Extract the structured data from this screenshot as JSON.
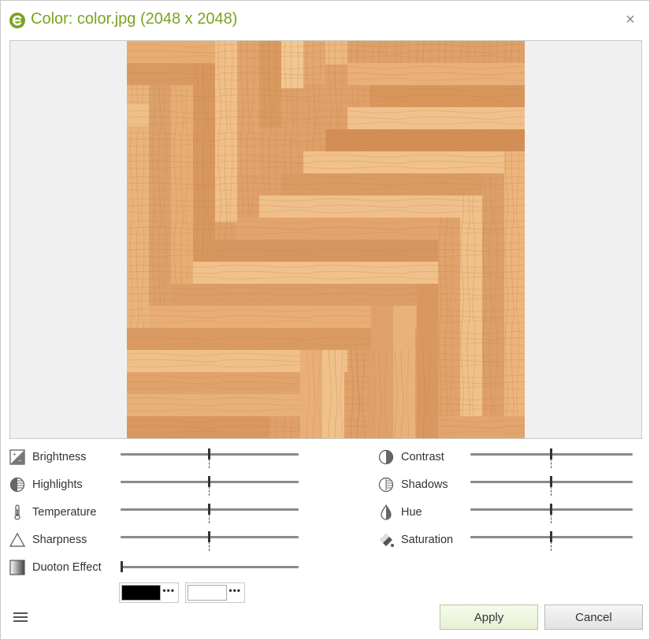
{
  "dialog": {
    "title": "Color: color.jpg (2048 x 2048)",
    "accent_color": "#7aa320",
    "close_icon": "close-icon"
  },
  "preview": {
    "image_description_icon": "herringbone-wood-texture"
  },
  "adjustments": {
    "left": [
      {
        "key": "brightness",
        "label": "Brightness",
        "icon": "brightness-icon",
        "level": 0.5
      },
      {
        "key": "highlights",
        "label": "Highlights",
        "icon": "highlights-icon",
        "level": 0.5
      },
      {
        "key": "temperature",
        "label": "Temperature",
        "icon": "thermometer-icon",
        "level": 0.5
      },
      {
        "key": "sharpness",
        "label": "Sharpness",
        "icon": "triangle-icon",
        "level": 0.5
      },
      {
        "key": "duoton",
        "label": "Duoton Effect",
        "icon": "gradient-icon",
        "level": 0.0
      }
    ],
    "right": [
      {
        "key": "contrast",
        "label": "Contrast",
        "icon": "contrast-icon",
        "level": 0.5
      },
      {
        "key": "shadows",
        "label": "Shadows",
        "icon": "shadows-icon",
        "level": 0.5
      },
      {
        "key": "hue",
        "label": "Hue",
        "icon": "drop-icon",
        "level": 0.5
      },
      {
        "key": "saturation",
        "label": "Saturation",
        "icon": "paint-bucket-icon",
        "level": 0.5
      }
    ]
  },
  "duoton": {
    "dark_color": "#000000",
    "light_color": "#ffffff",
    "more_label": "•••"
  },
  "footer": {
    "apply_label": "Apply",
    "cancel_label": "Cancel"
  }
}
